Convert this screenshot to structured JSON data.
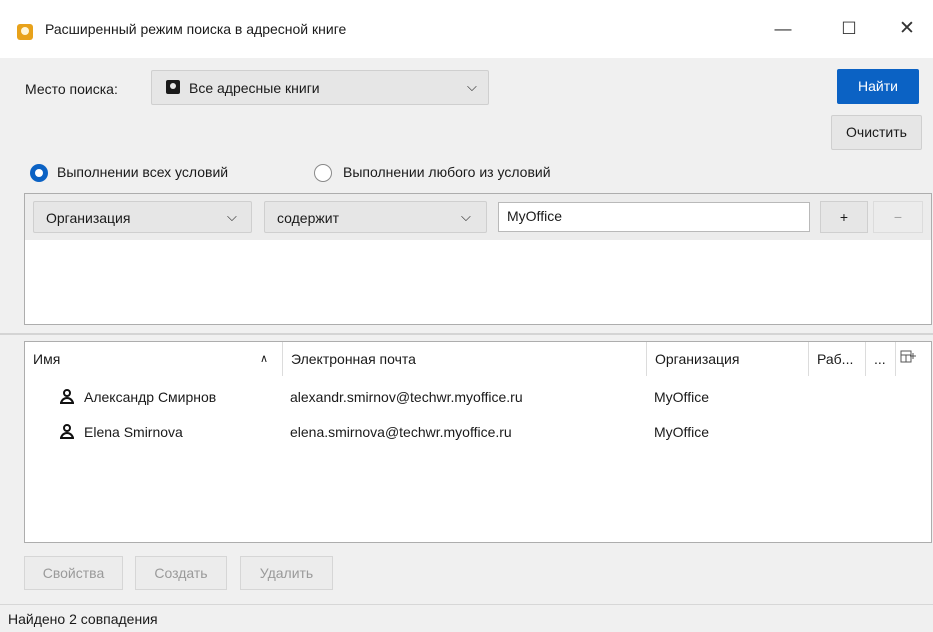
{
  "window": {
    "title": "Расширенный режим поиска в адресной книге"
  },
  "search": {
    "location_label": "Место поиска:",
    "location_value": "Все адресные книги",
    "find_button": "Найти",
    "clear_button": "Очистить"
  },
  "match": {
    "all_label": "Выполнении всех условий",
    "any_label": "Выполнении любого из условий",
    "selected": "all"
  },
  "condition": {
    "field": "Организация",
    "operator": "содержит",
    "value": "MyOffice",
    "add": "+",
    "remove": "−"
  },
  "results": {
    "columns": [
      "Имя",
      "Электронная почта",
      "Организация",
      "Раб...",
      "..."
    ],
    "rows": [
      {
        "name": "Александр Смирнов",
        "email": "alexandr.smirnov@techwr.myoffice.ru",
        "org": "MyOffice"
      },
      {
        "name": "Elena Smirnova",
        "email": "elena.smirnova@techwr.myoffice.ru",
        "org": "MyOffice"
      }
    ]
  },
  "actions": {
    "properties": "Свойства",
    "create": "Создать",
    "delete": "Удалить"
  },
  "status": "Найдено 2 совпадения",
  "colors": {
    "accent": "#0b62c4",
    "background": "#f0f0f0"
  }
}
